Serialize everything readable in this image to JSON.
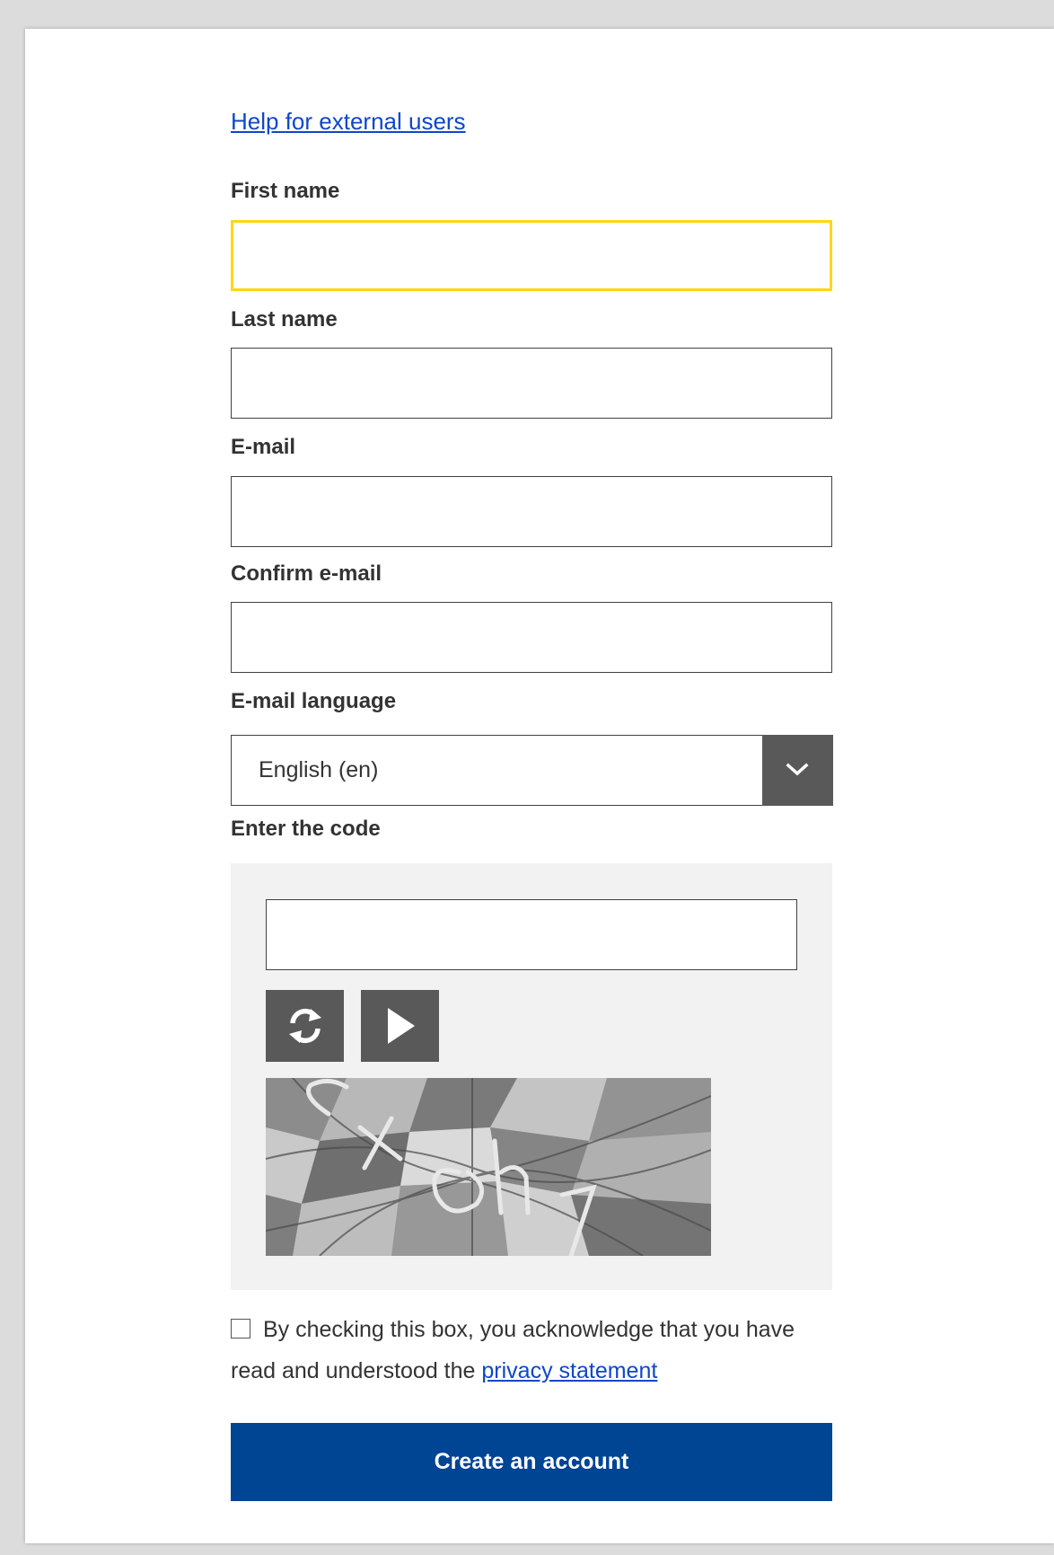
{
  "help_link": "Help for external users",
  "fields": {
    "first_name": {
      "label": "First name",
      "value": ""
    },
    "last_name": {
      "label": "Last name",
      "value": ""
    },
    "email": {
      "label": "E-mail",
      "value": ""
    },
    "confirm_email": {
      "label": "Confirm e-mail",
      "value": ""
    },
    "email_language": {
      "label": "E-mail language",
      "selected": "English (en)"
    }
  },
  "captcha": {
    "label": "Enter the code",
    "value": "",
    "refresh_icon": "refresh-icon",
    "play_icon": "play-audio-icon"
  },
  "consent": {
    "text": "By checking this box, you acknowledge that you have read and understood the",
    "link": "privacy statement",
    "checked": false
  },
  "submit_label": "Create an account",
  "colors": {
    "link": "#0e47cb",
    "focus_border": "#ffd617",
    "primary_button": "#004494",
    "icon_button": "#595959",
    "captcha_panel": "#f2f2f2"
  }
}
